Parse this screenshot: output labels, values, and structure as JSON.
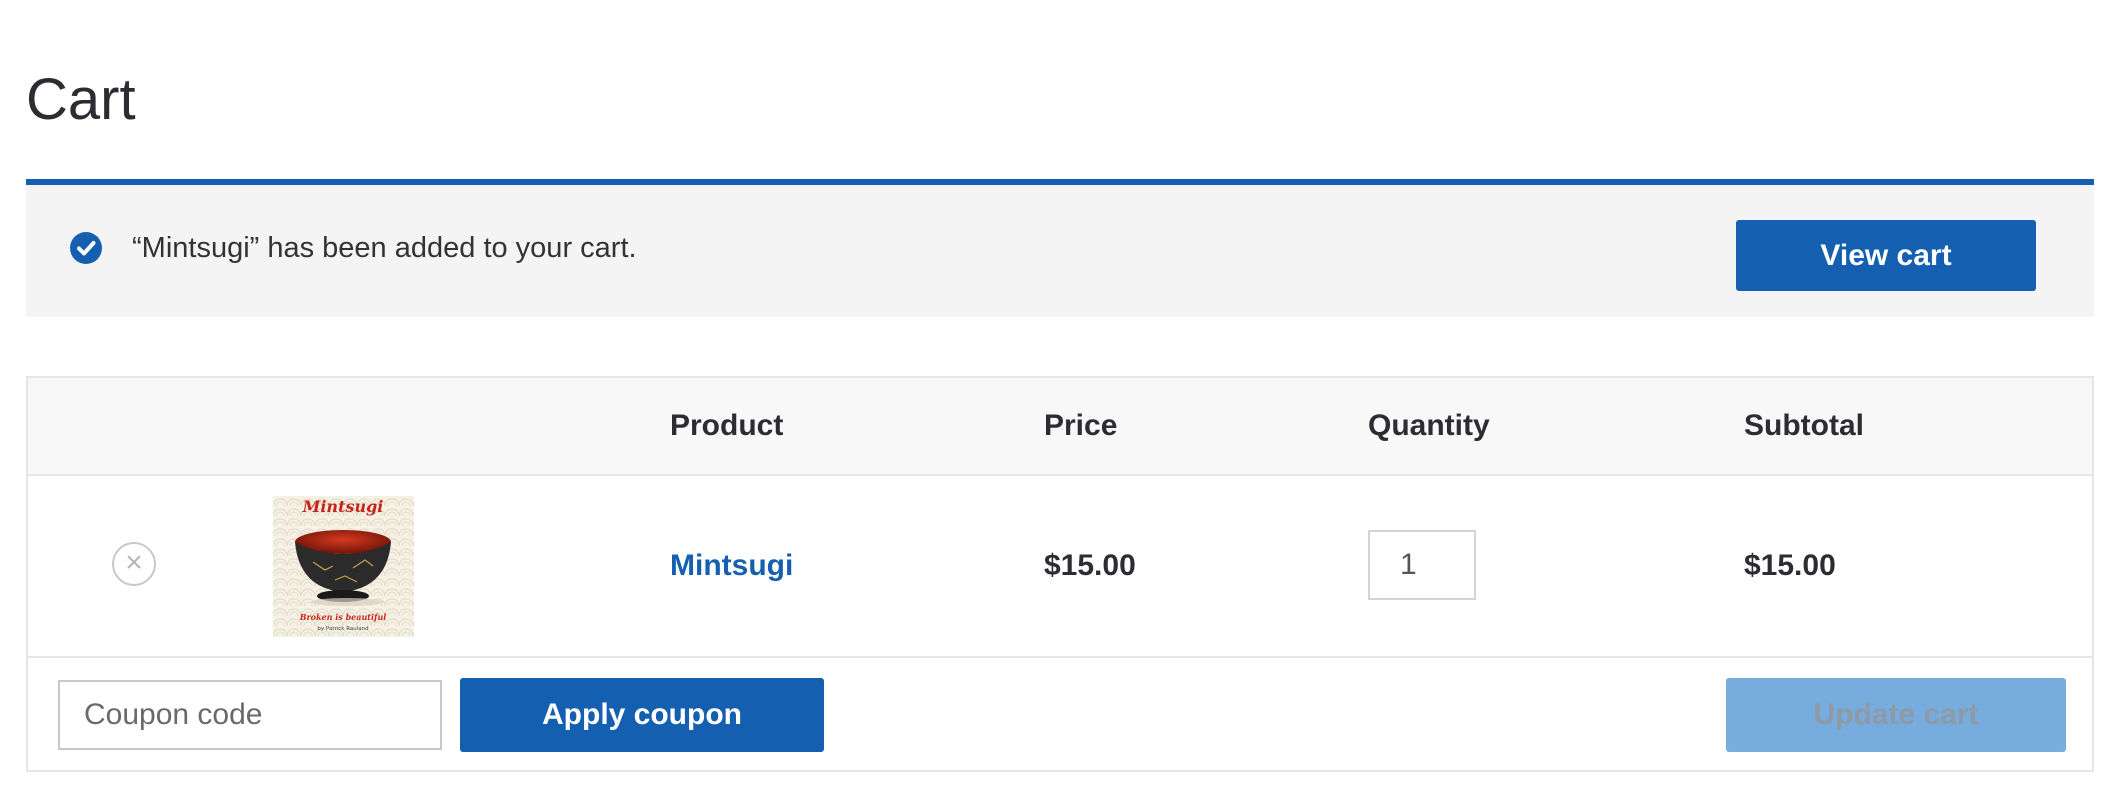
{
  "page": {
    "title": "Cart"
  },
  "notice": {
    "message": "“Mintsugi” has been added to your cart.",
    "view_cart_label": "View cart",
    "icon": "check-circle-icon",
    "accent_color": "#155fb1"
  },
  "table": {
    "headers": [
      "",
      "",
      "Product",
      "Price",
      "Quantity",
      "Subtotal"
    ],
    "rows": [
      {
        "remove_icon": "close-circle-icon",
        "thumbnail": {
          "title_text": "Mintsugi",
          "tagline": "Broken is beautiful",
          "author": "by Patrick Rauland"
        },
        "product": "Mintsugi",
        "price": "$15.00",
        "quantity": "1",
        "subtotal": "$15.00"
      }
    ]
  },
  "actions": {
    "coupon_placeholder": "Coupon code",
    "apply_coupon_label": "Apply coupon",
    "update_cart_label": "Update cart"
  },
  "colors": {
    "primary": "#155fb1",
    "primary_disabled": "#76acde",
    "notice_bg": "#f4f4f4",
    "table_header_bg": "#f8f8f8"
  }
}
